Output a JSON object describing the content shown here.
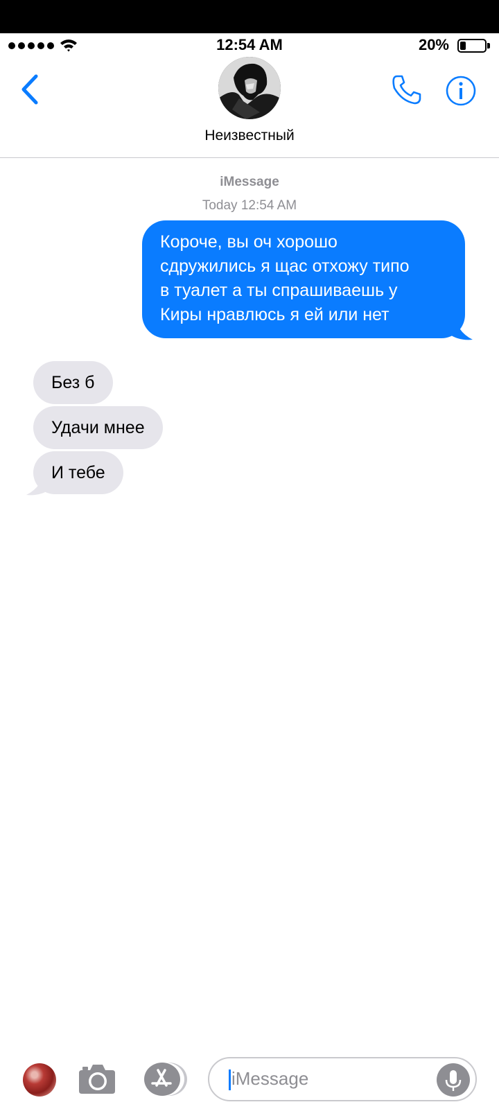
{
  "status_bar": {
    "time": "12:54 AM",
    "battery_percent": "20%",
    "signal_dots": 5,
    "battery_level": 0.2
  },
  "header": {
    "back_icon": "chevron-left-icon",
    "contact_name": "Неизвестный",
    "call_icon": "phone-icon",
    "info_icon": "info-icon"
  },
  "conversation": {
    "service_label": "iMessage",
    "timestamp": "Today 12:54 AM",
    "outgoing": [
      {
        "lines": [
          "Короче, вы оч хорошо",
          "сдружились я щас отхожу типо",
          "в туалет а ты спрашиваешь у",
          "Киры нравлюсь я ей или нет"
        ]
      }
    ],
    "incoming": [
      {
        "text": "Без б"
      },
      {
        "text": "Удачи мнее"
      },
      {
        "text": "И тебе"
      }
    ]
  },
  "composer": {
    "photos_icon": "photos-app-icon",
    "camera_icon": "camera-icon",
    "appstore_icon": "app-store-icon",
    "placeholder": "iMessage",
    "mic_icon": "microphone-icon"
  },
  "colors": {
    "accent": "#0a7cff",
    "incoming_bubble": "#e6e5eb",
    "secondary_text": "#8e8e93"
  }
}
